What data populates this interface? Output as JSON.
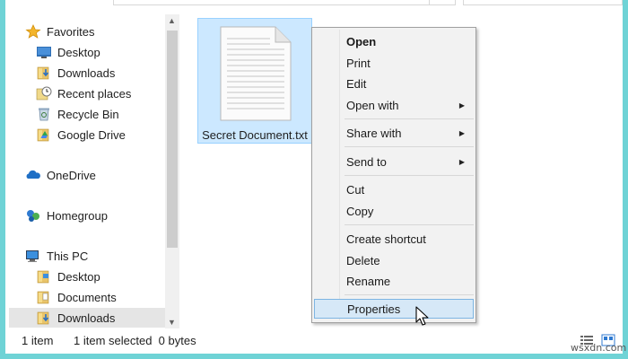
{
  "nav": {
    "favorites_label": "Favorites",
    "favorites_items": [
      "Desktop",
      "Downloads",
      "Recent places",
      "Recycle Bin",
      "Google Drive"
    ],
    "onedrive_label": "OneDrive",
    "homegroup_label": "Homegroup",
    "thispc_label": "This PC",
    "thispc_items": [
      "Desktop",
      "Documents",
      "Downloads"
    ]
  },
  "file": {
    "name": "Secret Document.txt"
  },
  "context_menu": {
    "open": "Open",
    "print": "Print",
    "edit": "Edit",
    "open_with": "Open with",
    "share_with": "Share with",
    "send_to": "Send to",
    "cut": "Cut",
    "copy": "Copy",
    "create_shortcut": "Create shortcut",
    "delete": "Delete",
    "rename": "Rename",
    "properties": "Properties"
  },
  "status": {
    "item_count": "1 item",
    "selection": "1 item selected  0 bytes"
  },
  "watermark": "wsxdn.com",
  "colors": {
    "frame": "#6fd3d6",
    "selection": "#cce8ff",
    "menu_hover": "#d6e8f7"
  }
}
